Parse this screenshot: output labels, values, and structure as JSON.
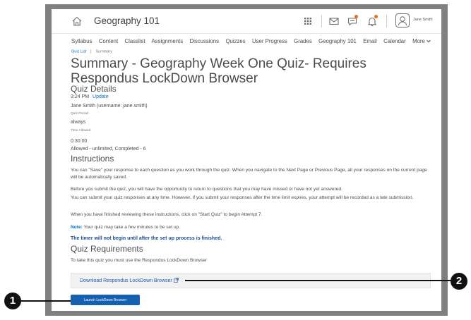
{
  "header": {
    "course_title": "Geography 101",
    "user_name": "Jane Smith",
    "accent_color": "#e8721c"
  },
  "nav": {
    "items": [
      "Syllabus",
      "Content",
      "Classlist",
      "Assignments",
      "Discussions",
      "Quizzes",
      "User Progress",
      "Grades",
      "Geography 101",
      "Email",
      "Calendar"
    ],
    "more_label": "More"
  },
  "breadcrumb": {
    "parent": "Quiz List",
    "current": "Summary"
  },
  "page": {
    "title": "Summary - Geography Week One Quiz- Requires Respondus LockDown Browser"
  },
  "quiz_details": {
    "heading": "Quiz Details",
    "time": "3:24 PM",
    "update_label": "Update",
    "user": "Jane Smith (username: jane.smith)",
    "quiz_period_label": "Quiz Period",
    "quiz_period_value": "always",
    "time_allowed_label": "Time Allowed",
    "time_allowed_value": "0:30:00",
    "attempts": "Allowed - unlimited, Completed - 6"
  },
  "instructions": {
    "heading": "Instructions",
    "p1": "You can \"Save\" your response to each question as you work through the quiz. When you navigate to the Next Page or Previous Page, all your responses on the current page will be automatically saved.",
    "p2": "Before you submit the quiz, you will have the opportunity to return to questions that you may have missed or have not yet answered.",
    "p3": "You can submit your quiz responses at any time. However, if you submit your responses after the time limit expires, your attempt will be recorded as a late submission.",
    "p4": "When you have finished reviewing these instructions, click on \"Start Quiz\" to begin Attempt 7.",
    "note_label": "Note:",
    "note_text": " Your quiz may take a few minutes to be set up.",
    "timer_text": "The timer will not begin until after the set up process is finished."
  },
  "requirements": {
    "heading": "Quiz Requirements",
    "text": "To take this quiz you must use the Respondus LockDown Browser",
    "download_label": "Download Respondus LockDown Browser",
    "launch_label": "Launch LockDown Browser"
  },
  "callouts": {
    "one": "1",
    "two": "2"
  }
}
